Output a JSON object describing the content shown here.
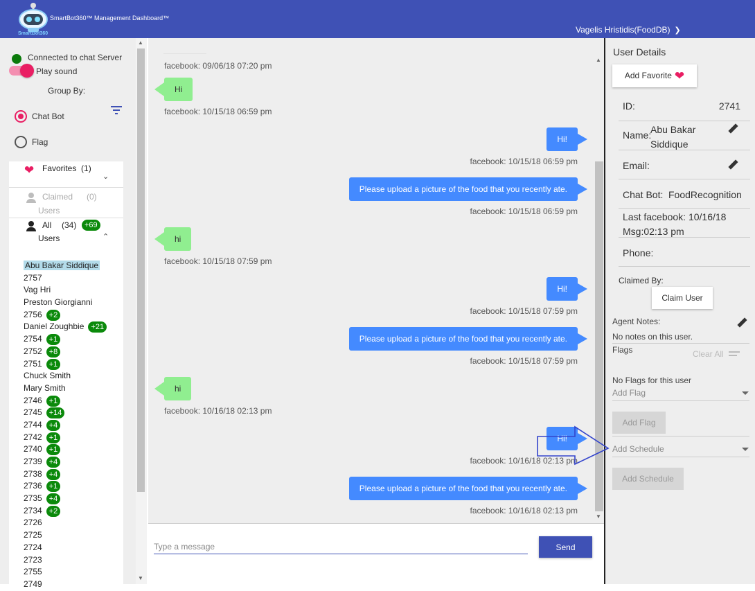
{
  "header": {
    "logo_text": "SmartBot360",
    "app_title": "SmartBot360™ Management Dashboard™",
    "user_name": "Vagelis Hristidis(FoodDB)"
  },
  "sidebar": {
    "connection_label": "Connected to chat Server",
    "sound_label": "Play sound",
    "group_by_label": "Group By:",
    "group_options": [
      {
        "label": "Chat Bot",
        "selected": true
      },
      {
        "label": "Flag",
        "selected": false
      }
    ],
    "favorites": {
      "label": "Favorites",
      "count": "(1)"
    },
    "claimed": {
      "label": "Claimed",
      "count": "(0)",
      "sub": "Users"
    },
    "all": {
      "label": "All",
      "count": "(34)",
      "badge": "+69",
      "sub": "Users"
    },
    "users": [
      {
        "name": "Abu Bakar Siddique",
        "badge": "",
        "selected": true
      },
      {
        "name": "2757",
        "badge": ""
      },
      {
        "name": "Vag Hri",
        "badge": ""
      },
      {
        "name": "Preston Giorgianni",
        "badge": ""
      },
      {
        "name": "2756",
        "badge": "+2"
      },
      {
        "name": "Daniel Zoughbie",
        "badge": "+21"
      },
      {
        "name": "2754",
        "badge": "+1"
      },
      {
        "name": "2752",
        "badge": "+8"
      },
      {
        "name": "2751",
        "badge": "+1"
      },
      {
        "name": "Chuck Smith",
        "badge": ""
      },
      {
        "name": "Mary Smith",
        "badge": ""
      },
      {
        "name": "2746",
        "badge": "+1"
      },
      {
        "name": "2745",
        "badge": "+14"
      },
      {
        "name": "2744",
        "badge": "+4"
      },
      {
        "name": "2742",
        "badge": "+1"
      },
      {
        "name": "2740",
        "badge": "+1"
      },
      {
        "name": "2739",
        "badge": "+4"
      },
      {
        "name": "2738",
        "badge": "+4"
      },
      {
        "name": "2736",
        "badge": "+1"
      },
      {
        "name": "2735",
        "badge": "+4"
      },
      {
        "name": "2734",
        "badge": "+2"
      },
      {
        "name": "2726",
        "badge": ""
      },
      {
        "name": "2725",
        "badge": ""
      },
      {
        "name": "2724",
        "badge": ""
      },
      {
        "name": "2723",
        "badge": ""
      },
      {
        "name": "2755",
        "badge": ""
      },
      {
        "name": "2749",
        "badge": ""
      }
    ]
  },
  "chat": {
    "messages": [
      {
        "ts": "facebook: 09/06/18 07:20 pm"
      },
      {
        "dir": "in",
        "text": "Hi",
        "ts": "facebook: 10/15/18 06:59 pm"
      },
      {
        "dir": "out",
        "text": "Hi!",
        "ts": "facebook: 10/15/18 06:59 pm"
      },
      {
        "dir": "out",
        "text": "Please upload a picture of the food that you recently ate.",
        "ts": "facebook: 10/15/18 06:59 pm"
      },
      {
        "dir": "in",
        "text": "hi",
        "ts": "facebook: 10/15/18 07:59 pm"
      },
      {
        "dir": "out",
        "text": "Hi!",
        "ts": "facebook: 10/15/18 07:59 pm"
      },
      {
        "dir": "out",
        "text": "Please upload a picture of the food that you recently ate.",
        "ts": "facebook: 10/15/18 07:59 pm"
      },
      {
        "dir": "in",
        "text": "hi",
        "ts": "facebook: 10/16/18 02:13 pm"
      },
      {
        "dir": "out",
        "text": "Hi!",
        "ts": "facebook: 10/16/18 02:13 pm"
      },
      {
        "dir": "out",
        "text": "Please upload a picture of the food that you recently ate.",
        "ts": "facebook: 10/16/18 02:13 pm"
      }
    ],
    "input_placeholder": "Type a message",
    "send_label": "Send"
  },
  "details": {
    "title": "User Details",
    "add_favorite_label": "Add Favorite",
    "id_label": "ID:",
    "id_value": "2741",
    "name_label": "Name:",
    "name_value": "Abu Bakar Siddique",
    "email_label": "Email:",
    "chatbot_label": "Chat Bot:",
    "chatbot_value": "FoodRecognition",
    "last_msg_label": "Last facebook: 10/16/18 Msg:02:13 pm",
    "phone_label": "Phone:",
    "claimed_by_label": "Claimed By:",
    "claim_button": "Claim User",
    "agent_notes_label": "Agent Notes:",
    "agent_notes_value": "No notes on this user.",
    "flags_label": "Flags",
    "clear_all_label": "Clear All",
    "no_flags_text": "No Flags for this user",
    "add_flag_select": "Add Flag",
    "add_flag_button": "Add Flag",
    "add_schedule_select": "Add Schedule",
    "add_schedule_button": "Add Schedule"
  },
  "colors": {
    "primary": "#3f51b5",
    "accent": "#e91e63",
    "badge": "#0b8a0b",
    "outgoing_bubble": "#448aff",
    "incoming_bubble": "#90ee90"
  }
}
